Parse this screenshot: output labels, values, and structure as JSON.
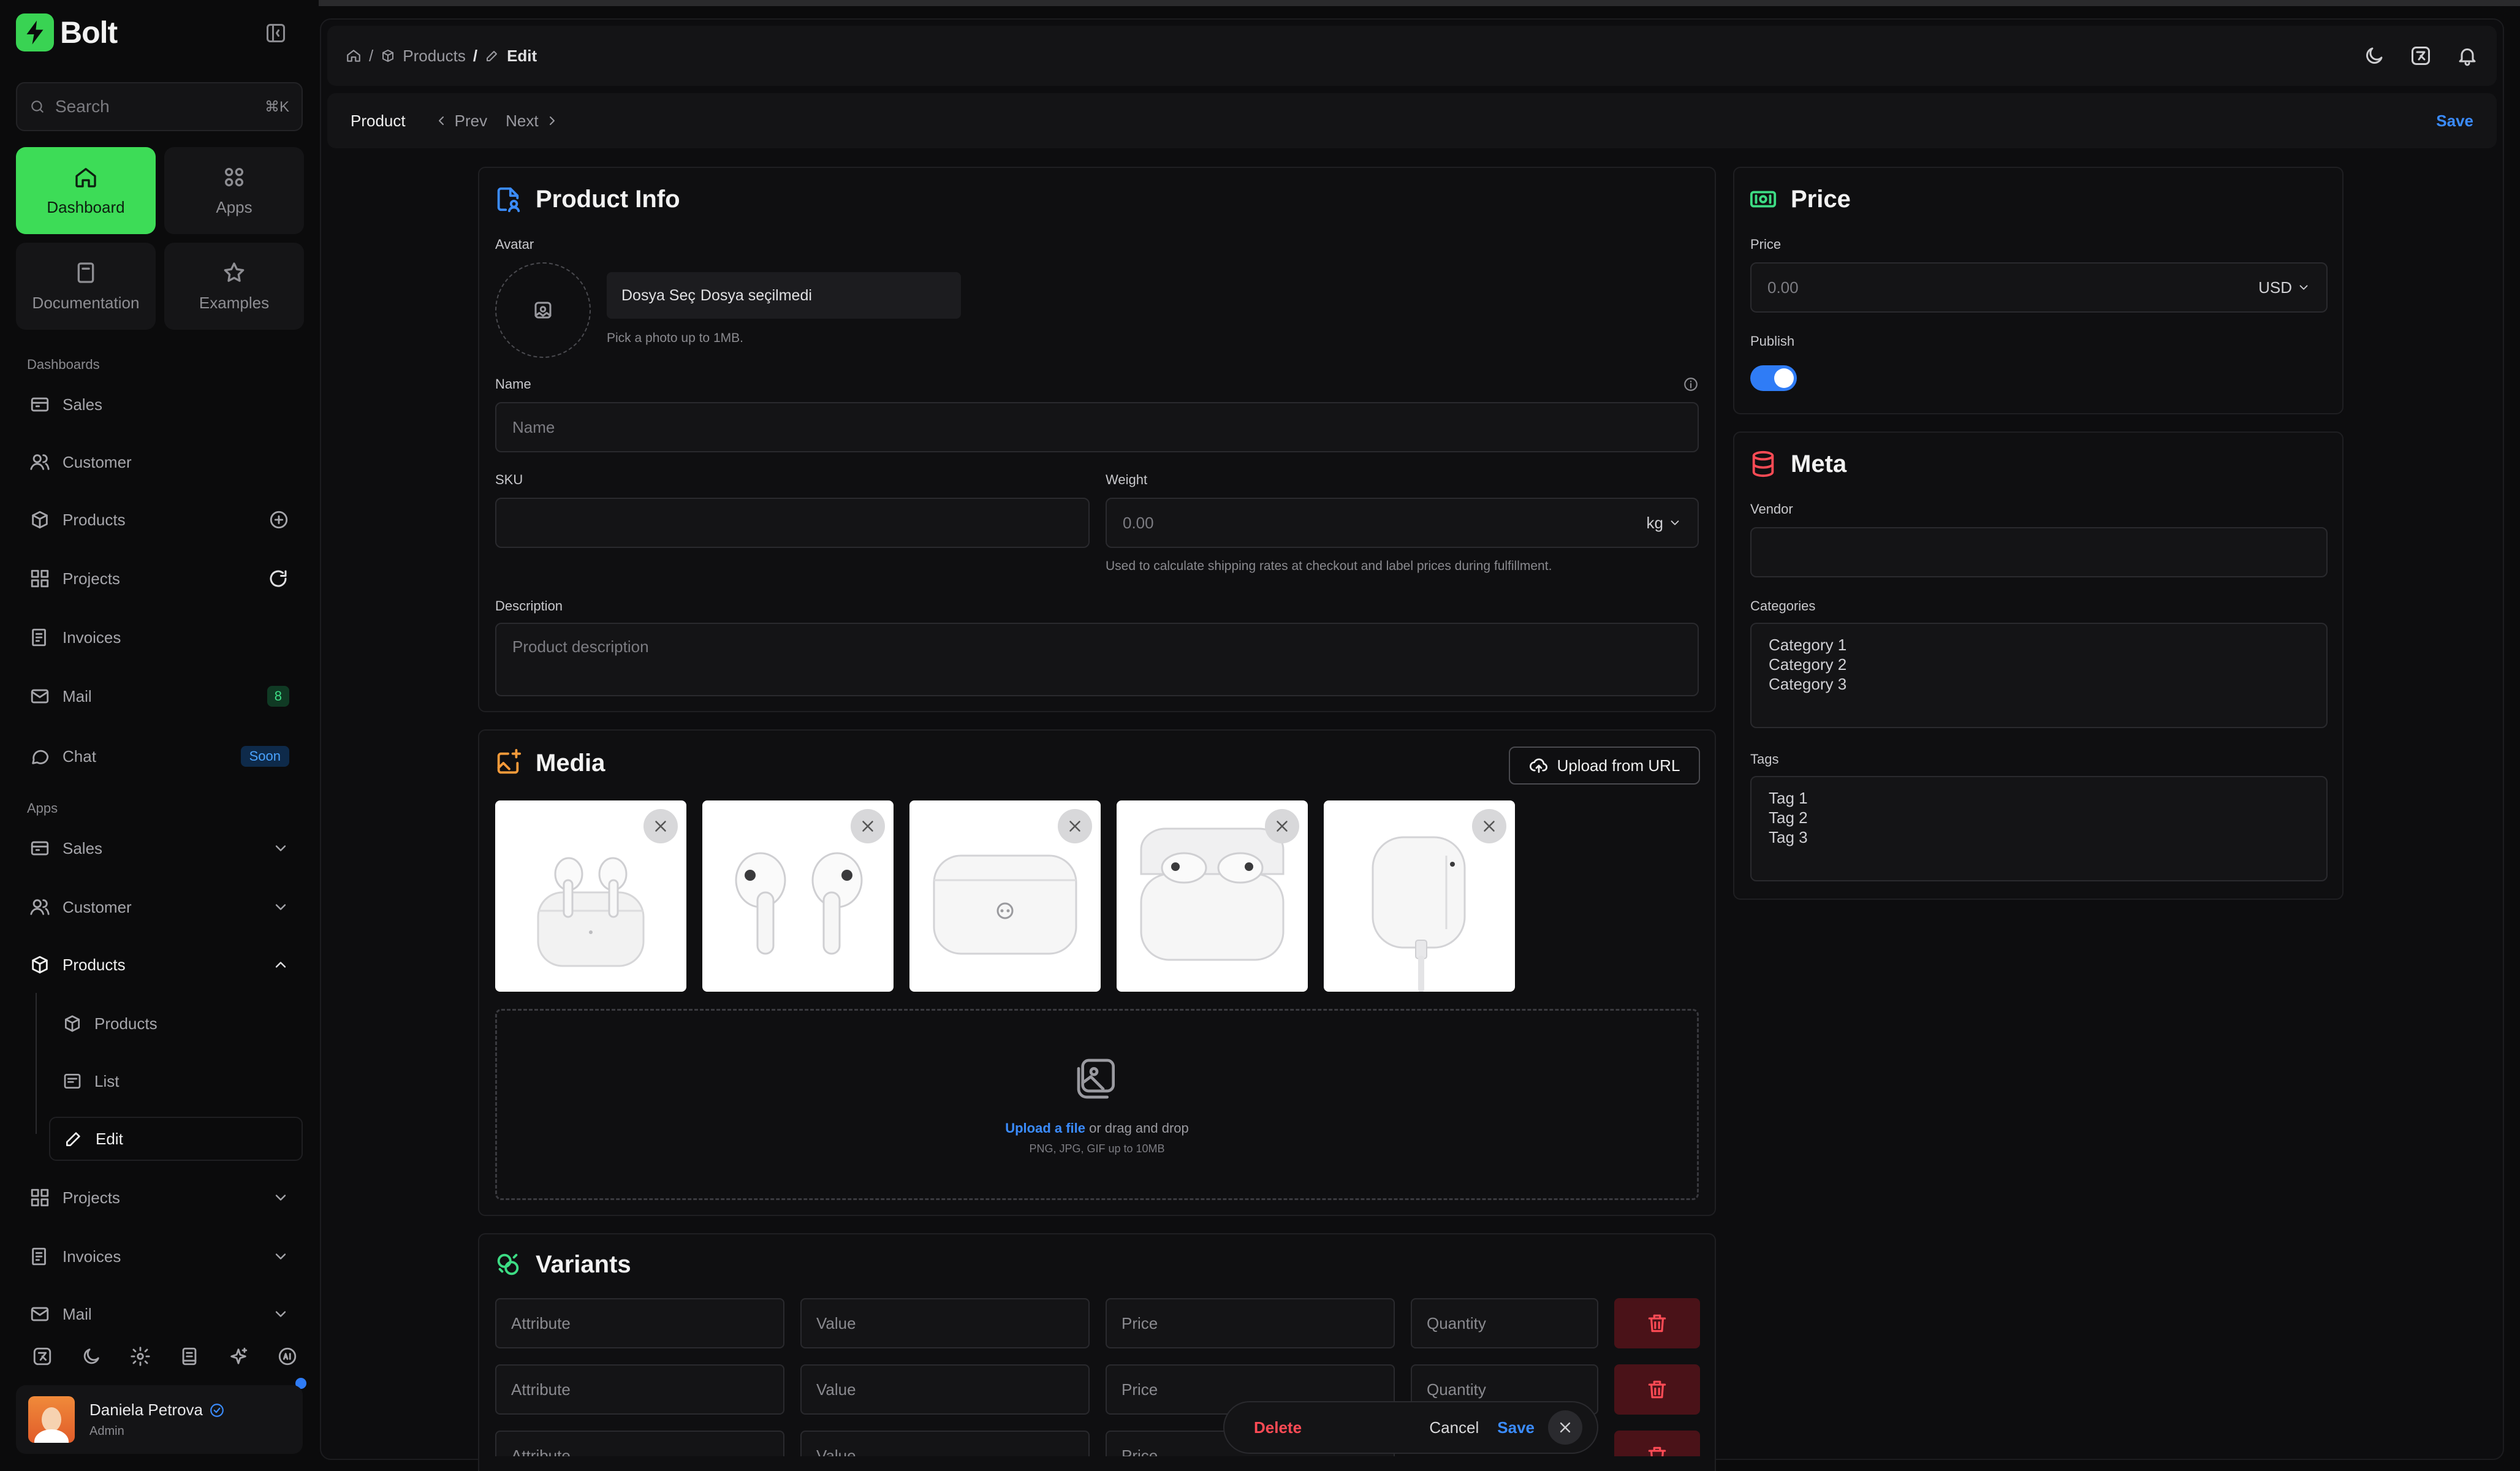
{
  "sidebar": {
    "brand": "Bolt",
    "search": {
      "placeholder": "Search",
      "shortcut": "⌘K"
    },
    "tiles": [
      {
        "label": "Dashboard",
        "icon": "home-icon",
        "active": true
      },
      {
        "label": "Apps",
        "icon": "grid-icon"
      },
      {
        "label": "Documentation",
        "icon": "book-icon"
      },
      {
        "label": "Examples",
        "icon": "star-icon"
      }
    ],
    "sections": {
      "dashboards": "Dashboards",
      "apps": "Apps"
    },
    "dashboards": [
      {
        "label": "Sales",
        "icon": "chart-icon"
      },
      {
        "label": "Customer",
        "icon": "users-icon"
      },
      {
        "label": "Products",
        "icon": "box-icon"
      },
      {
        "label": "Projects",
        "icon": "kanban-icon"
      },
      {
        "label": "Invoices",
        "icon": "invoice-icon"
      },
      {
        "label": "Mail",
        "icon": "mail-icon",
        "badge": "8"
      },
      {
        "label": "Chat",
        "icon": "chat-icon",
        "badge": "Soon"
      }
    ],
    "apps": [
      {
        "label": "Sales"
      },
      {
        "label": "Customer"
      },
      {
        "label": "Products"
      },
      {
        "label": "Products"
      },
      {
        "label": "List"
      },
      {
        "label": "Edit"
      },
      {
        "label": "Projects"
      },
      {
        "label": "Invoices"
      },
      {
        "label": "Mail"
      }
    ],
    "user": {
      "name": "Daniela Petrova",
      "role": "Admin"
    }
  },
  "topbar": {
    "breadcrumbs": [
      "/",
      "Products",
      "/",
      "Edit"
    ]
  },
  "subbar": {
    "product": "Product",
    "prev": "Prev",
    "next": "Next",
    "save": "Save"
  },
  "product_info": {
    "title": "Product Info",
    "avatar_label": "Avatar",
    "file_button": "Dosya Seç",
    "file_status": "Dosya seçilmedi",
    "avatar_hint": "Pick a photo up to 1MB.",
    "name_label": "Name",
    "name_placeholder": "Name",
    "sku_label": "SKU",
    "weight_label": "Weight",
    "weight_placeholder": "0.00",
    "weight_unit": "kg",
    "weight_hint": "Used to calculate shipping rates at checkout and label prices during fulfillment.",
    "description_label": "Description",
    "description_placeholder": "Product description"
  },
  "media": {
    "title": "Media",
    "upload_url": "Upload from URL",
    "upload_link": "Upload a file",
    "upload_text": " or drag and drop",
    "upload_sub": "PNG, JPG, GIF up to 10MB"
  },
  "variants": {
    "title": "Variants",
    "placeholders": {
      "attribute": "Attribute",
      "value": "Value",
      "price": "Price",
      "quantity": "Quantity"
    }
  },
  "price": {
    "title": "Price",
    "price_label": "Price",
    "price_placeholder": "0.00",
    "currency": "USD",
    "publish_label": "Publish",
    "publish_on": true
  },
  "meta": {
    "title": "Meta",
    "vendor_label": "Vendor",
    "categories_label": "Categories",
    "categories": [
      "Category 1",
      "Category 2",
      "Category 3"
    ],
    "tags_label": "Tags",
    "tags": [
      "Tag 1",
      "Tag 2",
      "Tag 3"
    ]
  },
  "action_bar": {
    "delete": "Delete",
    "cancel": "Cancel",
    "save": "Save"
  },
  "colors": {
    "brand": "#3ddc57",
    "accent": "#2f7cf6",
    "danger": "#ff4b55"
  }
}
